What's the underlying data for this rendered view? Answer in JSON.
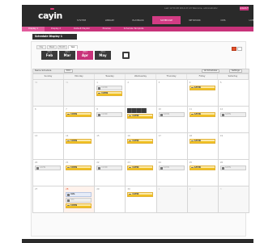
{
  "app": {
    "logo": "cayin",
    "status_line": "Last 12:50:48 2014-07-23  Welcome, administrator",
    "logout_label": "LOGOUT",
    "nav": [
      {
        "label": "SYSTEM",
        "active": false
      },
      {
        "label": "LIBRARY",
        "active": false
      },
      {
        "label": "PLAYBACK",
        "active": false
      },
      {
        "label": "SCHEDULE",
        "active": true
      },
      {
        "label": "NETWORK",
        "active": false
      },
      {
        "label": "CMS",
        "active": false
      },
      {
        "label": "LIVE",
        "active": false
      }
    ],
    "subnav": [
      {
        "label": "Display 1",
        "active": true
      },
      {
        "label": "Display 2",
        "active": false
      },
      {
        "label": "Default Playlist",
        "active": false
      },
      {
        "label": "Preview",
        "active": false
      },
      {
        "label": "Schedule Template",
        "active": false
      }
    ]
  },
  "schedule": {
    "title": "Schedule Display 1",
    "view_tabs": [
      {
        "label": "Day",
        "active": false
      },
      {
        "label": "Week",
        "active": false
      },
      {
        "label": "Month",
        "active": false
      },
      {
        "label": "Year",
        "active": true
      }
    ],
    "months": [
      {
        "year": "2014",
        "month": "Feb"
      },
      {
        "year": "2014",
        "month": "Mar"
      },
      {
        "year": "2014",
        "month": "Apr",
        "selected": true
      },
      {
        "year": "2014",
        "month": "May"
      }
    ],
    "toolbar": {
      "name_label": "Name Schedule",
      "edit_label": "Edit",
      "all_schedules_label": "All Schedules",
      "settings_label": "Settings"
    },
    "weekdays": [
      "Sunday",
      "Monday",
      "Tuesday",
      "Wednesday",
      "Thursday",
      "Friday",
      "Saturday"
    ],
    "weeks": [
      [
        {
          "day": "30",
          "out": true
        },
        {
          "day": "31",
          "out": true
        },
        {
          "day": "1",
          "events": [
            {
              "label": "CAYIN",
              "style": "grey"
            },
            {
              "label": "CAYIN",
              "style": "gold"
            }
          ]
        },
        {
          "day": "2"
        },
        {
          "day": "3"
        },
        {
          "day": "4",
          "events": [
            {
              "label": "CAYIN",
              "style": "gold"
            }
          ]
        },
        {
          "day": "5"
        }
      ],
      [
        {
          "day": "6"
        },
        {
          "day": "7",
          "events": [
            {
              "label": "CAYIN",
              "style": "gold"
            }
          ]
        },
        {
          "day": "8",
          "events": [
            {
              "label": "CAYIN",
              "style": "grey"
            }
          ]
        },
        {
          "day": "9",
          "events": [
            {
              "label": "CAYIN",
              "style": "gold"
            }
          ],
          "controls": true
        },
        {
          "day": "10",
          "events": [
            {
              "label": "CAYIN",
              "style": "grey"
            }
          ]
        },
        {
          "day": "11",
          "events": [
            {
              "label": "CAYIN",
              "style": "gold"
            }
          ]
        },
        {
          "day": "12",
          "events": [
            {
              "label": "CAYIN",
              "style": "grey"
            }
          ]
        }
      ],
      [
        {
          "day": "13"
        },
        {
          "day": "14",
          "events": [
            {
              "label": "CAYIN",
              "style": "gold"
            }
          ]
        },
        {
          "day": "15"
        },
        {
          "day": "16",
          "events": [
            {
              "label": "CAYIN",
              "style": "gold"
            }
          ]
        },
        {
          "day": "17"
        },
        {
          "day": "18",
          "events": [
            {
              "label": "CAYIN",
              "style": "gold"
            }
          ]
        },
        {
          "day": "19"
        }
      ],
      [
        {
          "day": "20",
          "events": [
            {
              "label": "CAYIN",
              "style": "grey"
            }
          ]
        },
        {
          "day": "21",
          "events": [
            {
              "label": "CAYIN",
              "style": "gold"
            }
          ]
        },
        {
          "day": "22",
          "events": [
            {
              "label": "CAYIN",
              "style": "grey"
            }
          ]
        },
        {
          "day": "23",
          "events": [
            {
              "label": "CAYIN",
              "style": "gold"
            }
          ]
        },
        {
          "day": "24",
          "events": [
            {
              "label": "CAYIN",
              "style": "grey"
            }
          ]
        },
        {
          "day": "25",
          "events": [
            {
              "label": "CAYIN",
              "style": "gold"
            }
          ]
        },
        {
          "day": "26",
          "events": [
            {
              "label": "CAYIN",
              "style": "grey"
            }
          ]
        }
      ],
      [
        {
          "day": "27"
        },
        {
          "day": "28",
          "today": true,
          "events": [
            {
              "label": "info",
              "style": "blue"
            },
            {
              "label": "info",
              "style": "grey"
            },
            {
              "label": "CAYIN",
              "style": "gold"
            }
          ]
        },
        {
          "day": "29"
        },
        {
          "day": "30",
          "events": [
            {
              "label": "CAYIN",
              "style": "gold"
            }
          ]
        },
        {
          "day": "1",
          "out": true
        },
        {
          "day": "2",
          "out": true
        },
        {
          "day": "3",
          "out": true
        }
      ]
    ]
  },
  "colors": {
    "brand_pink": "#c8327a",
    "header_dark": "#2a2a2a",
    "event_gold": "#f0c020",
    "today_red": "#e2502a"
  }
}
